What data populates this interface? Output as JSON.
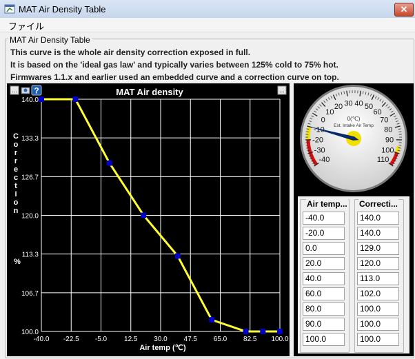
{
  "window": {
    "title": "MAT Air Density Table",
    "close_label": "✕",
    "icon": "app-window-icon"
  },
  "menu": {
    "file": "ファイル"
  },
  "panel": {
    "title": "MAT Air Density Table",
    "lines": [
      "This curve is the whole air density correction exposed in full.",
      "It is based on the 'ideal gas law' and typically varies between 125% cold to 75% hot.",
      "Firmwares 1.1.x and earlier used an embedded curve and a correction curve on top."
    ]
  },
  "chart_toolbar": {
    "menu_left": "...",
    "menu_right": "...",
    "help": "?",
    "icons": [
      "menu-dots-icon",
      "export-image-icon",
      "help-icon",
      "menu-dots-icon"
    ]
  },
  "chart_data": {
    "type": "line",
    "title": "MAT Air density",
    "xlabel": "Air temp (℃)",
    "ylabel": "Correction",
    "yunit": "%",
    "xlim": [
      -40,
      100
    ],
    "ylim": [
      100,
      140
    ],
    "x_ticks": [
      "-40.0",
      "-22.5",
      "-5.0",
      "12.5",
      "30.0",
      "47.5",
      "65.0",
      "82.5",
      "100.0"
    ],
    "y_ticks": [
      "140.0",
      "133.3",
      "126.7",
      "120.0",
      "113.3",
      "106.7",
      "100.0"
    ],
    "x": [
      -40,
      -20,
      0,
      20,
      40,
      60,
      80,
      90,
      100
    ],
    "values": [
      140,
      140,
      129,
      120,
      113,
      102,
      100,
      100,
      100
    ],
    "grid": true,
    "line_color": "#ffff33",
    "point_color": "#0000cc"
  },
  "gauge": {
    "label": "Est. Intake Air Temp",
    "readout": "0(℃)",
    "ticks": [
      "-40",
      "-30",
      "-20",
      "-10",
      "0",
      "10",
      "20",
      "30",
      "40",
      "50",
      "60",
      "70",
      "80",
      "90",
      "100",
      "110"
    ],
    "value": -10,
    "min": -40,
    "max": 110
  },
  "table": {
    "headers": [
      "Air temp...",
      "Correcti..."
    ],
    "col1": [
      "-40.0",
      "-20.0",
      "0.0",
      "20.0",
      "40.0",
      "60.0",
      "80.0",
      "90.0",
      "100.0"
    ],
    "col2": [
      "140.0",
      "140.0",
      "129.0",
      "120.0",
      "113.0",
      "102.0",
      "100.0",
      "100.0",
      "100.0"
    ]
  }
}
